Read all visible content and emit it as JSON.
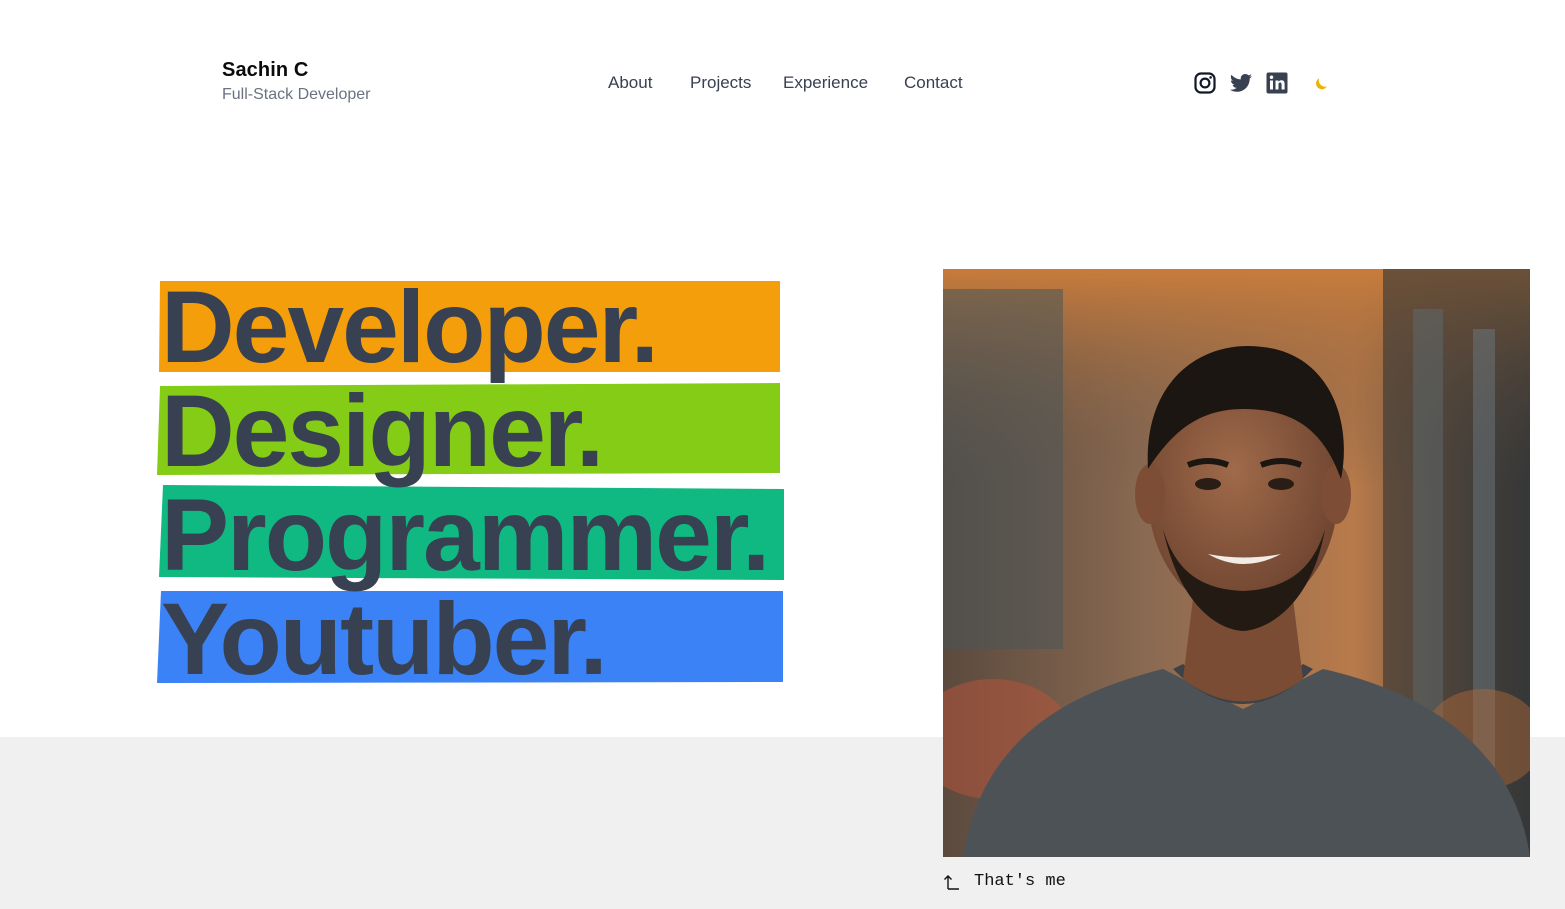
{
  "header": {
    "name": "Sachin C",
    "role": "Full-Stack Developer",
    "nav": [
      "About",
      "Projects",
      "Experience",
      "Contact"
    ],
    "socials": [
      "instagram-icon",
      "twitter-icon",
      "linkedin-icon"
    ],
    "theme_toggle_icon": "moon-icon"
  },
  "hero": {
    "roles": [
      {
        "text": "Developer.",
        "color": "#F59E0B"
      },
      {
        "text": "Designer.",
        "color": "#84CC16"
      },
      {
        "text": "Programmer.",
        "color": "#10B981"
      },
      {
        "text": "Youtuber.",
        "color": "#3B82F6"
      }
    ],
    "photo_caption": "That's me",
    "photo_icon": "portrait-photo"
  },
  "colors": {
    "text_dark": "#374151",
    "moon": "#EAB308",
    "band": "#F0F0F0"
  }
}
